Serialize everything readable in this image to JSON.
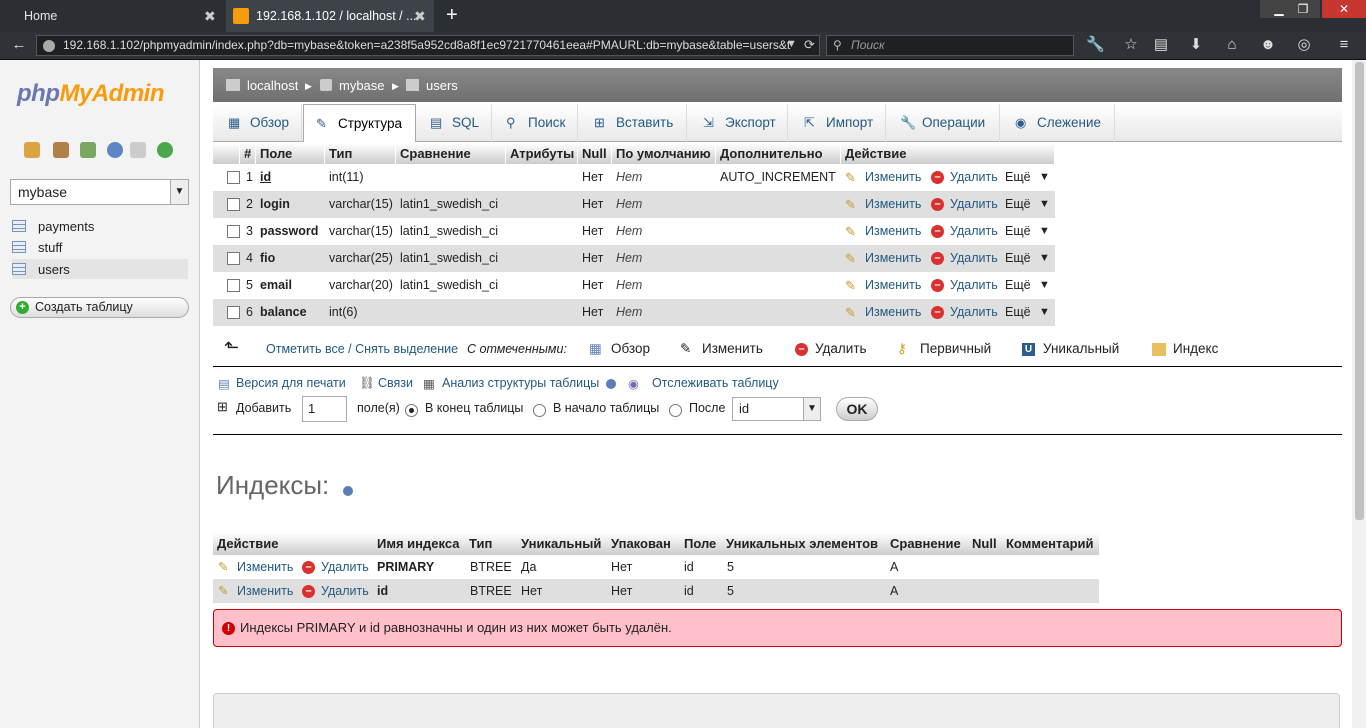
{
  "browser": {
    "tabs": [
      {
        "title": "Home",
        "close": "✖"
      },
      {
        "title": "192.168.1.102 / localhost / ...",
        "close": "✖"
      }
    ],
    "new_tab": "+",
    "url": "192.168.1.102/phpmyadmin/index.php?db=mybase&token=a238f5a952cd8a8f1ec9721770461eea#PMAURL:db=mybase&table=users&t",
    "search_placeholder": "Поиск"
  },
  "sidebar": {
    "logo_part1": "php",
    "logo_part2": "MyAdmin",
    "db_selected": "mybase",
    "tables": [
      "payments",
      "stuff",
      "users"
    ],
    "create_table": "Создать таблицу"
  },
  "breadcrumb": [
    "localhost",
    "mybase",
    "users"
  ],
  "tabs": [
    "Обзор",
    "Структура",
    "SQL",
    "Поиск",
    "Вставить",
    "Экспорт",
    "Импорт",
    "Операции",
    "Слежение"
  ],
  "structure": {
    "headers": [
      "#",
      "Поле",
      "Тип",
      "Сравнение",
      "Атрибуты",
      "Null",
      "По умолчанию",
      "Дополнительно",
      "Действие"
    ],
    "rows": [
      {
        "num": "1",
        "field": "id",
        "type": "int(11)",
        "collation": "",
        "null": "Нет",
        "default": "Нет",
        "extra": "AUTO_INCREMENT"
      },
      {
        "num": "2",
        "field": "login",
        "type": "varchar(15)",
        "collation": "latin1_swedish_ci",
        "null": "Нет",
        "default": "Нет",
        "extra": ""
      },
      {
        "num": "3",
        "field": "password",
        "type": "varchar(15)",
        "collation": "latin1_swedish_ci",
        "null": "Нет",
        "default": "Нет",
        "extra": ""
      },
      {
        "num": "4",
        "field": "fio",
        "type": "varchar(25)",
        "collation": "latin1_swedish_ci",
        "null": "Нет",
        "default": "Нет",
        "extra": ""
      },
      {
        "num": "5",
        "field": "email",
        "type": "varchar(20)",
        "collation": "latin1_swedish_ci",
        "null": "Нет",
        "default": "Нет",
        "extra": ""
      },
      {
        "num": "6",
        "field": "balance",
        "type": "int(6)",
        "collation": "",
        "null": "Нет",
        "default": "Нет",
        "extra": ""
      }
    ],
    "action_change": "Изменить",
    "action_delete": "Удалить",
    "action_more": "Ещё"
  },
  "with_selected": {
    "check_all": "Отметить все / Снять выделение",
    "label": "С отмеченными:",
    "actions": [
      "Обзор",
      "Изменить",
      "Удалить",
      "Первичный",
      "Уникальный",
      "Индекс"
    ]
  },
  "links": {
    "print": "Версия для печати",
    "relations": "Связи",
    "analyze": "Анализ структуры таблицы",
    "track": "Отслеживать таблицу"
  },
  "add_fields": {
    "label": "Добавить",
    "count": "1",
    "fields_label": "поле(я)",
    "at_end": "В конец таблицы",
    "at_begin": "В начало таблицы",
    "after": "После",
    "after_field": "id",
    "ok": "OK"
  },
  "indexes": {
    "title": "Индексы:",
    "headers": [
      "Действие",
      "Имя индекса",
      "Тип",
      "Уникальный",
      "Упакован",
      "Поле",
      "Уникальных элементов",
      "Сравнение",
      "Null",
      "Комментарий"
    ],
    "rows": [
      {
        "name": "PRIMARY",
        "type": "BTREE",
        "unique": "Да",
        "packed": "Нет",
        "field": "id",
        "cardinality": "5",
        "collation": "A"
      },
      {
        "name": "id",
        "type": "BTREE",
        "unique": "Нет",
        "packed": "Нет",
        "field": "id",
        "cardinality": "5",
        "collation": "A"
      }
    ]
  },
  "warning": "Индексы PRIMARY и id равнозначны и один из них может быть удалён."
}
